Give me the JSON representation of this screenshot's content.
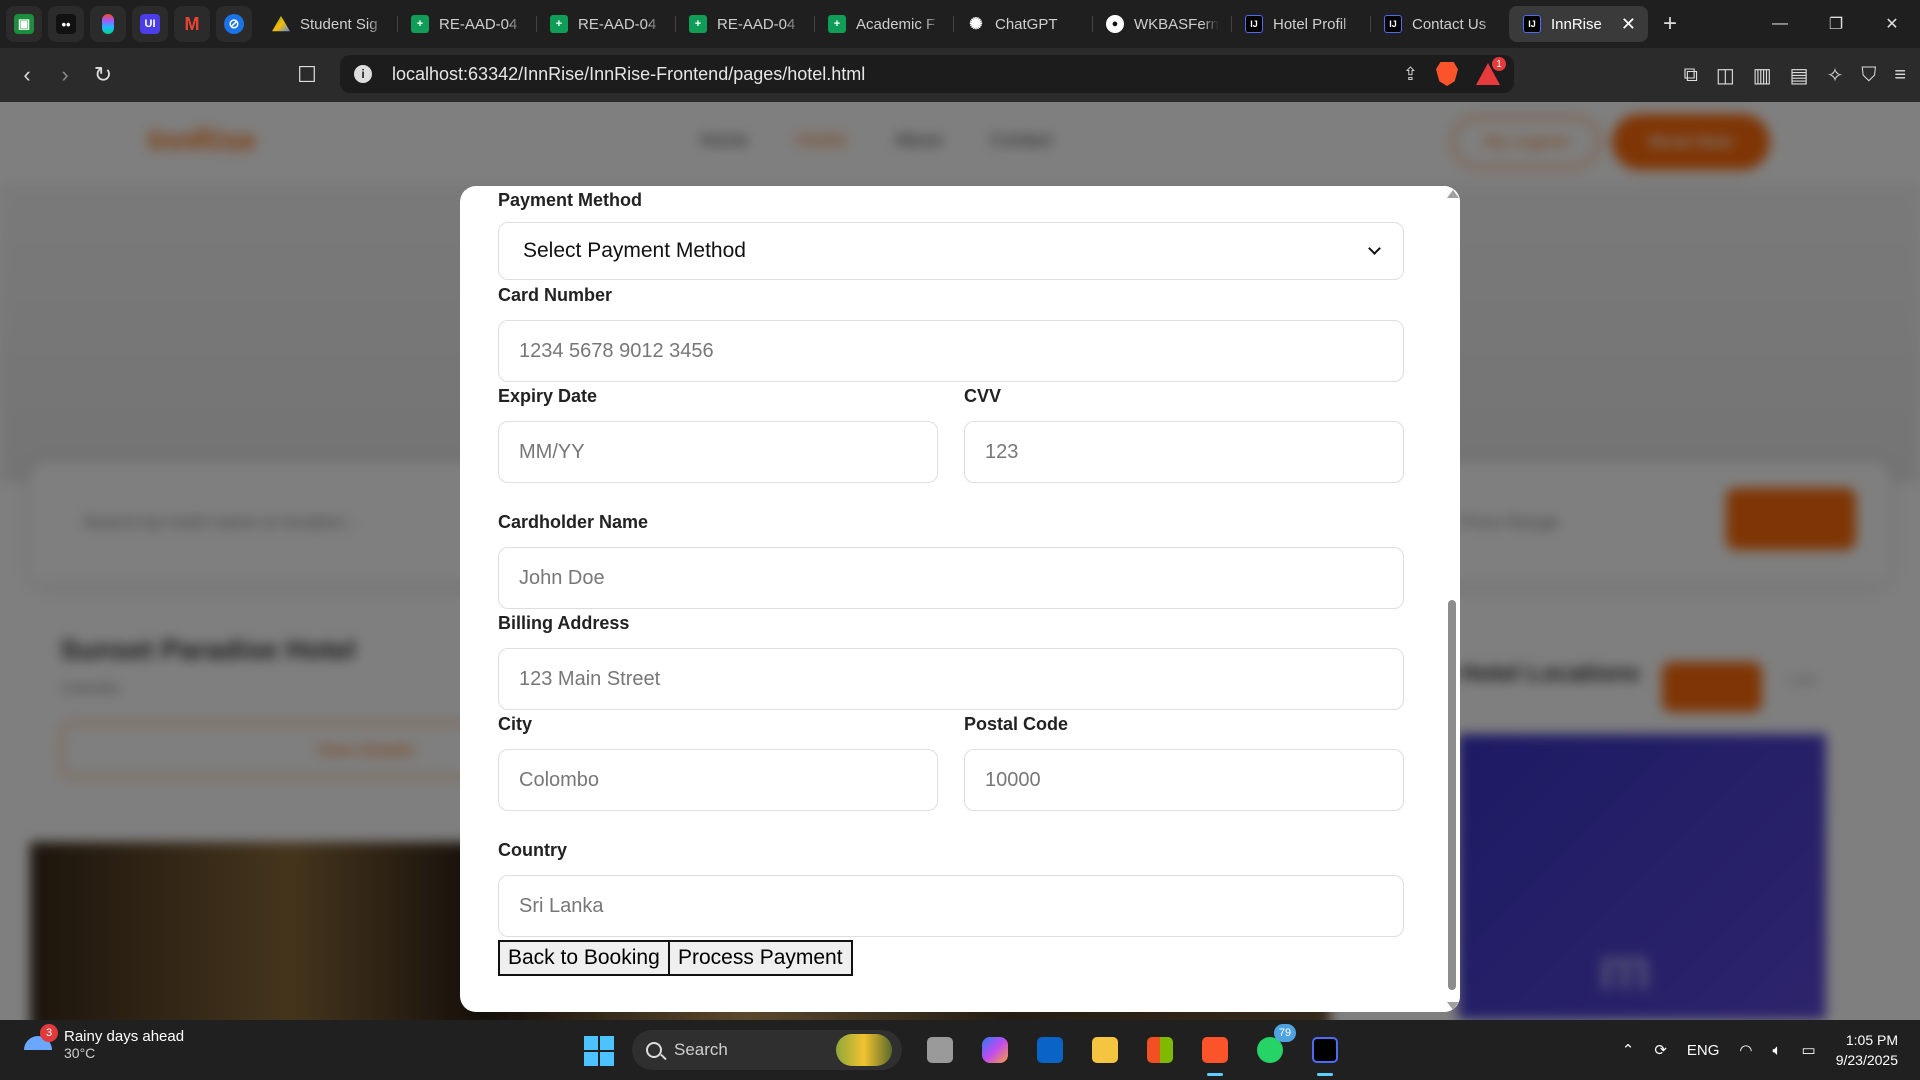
{
  "browser": {
    "pinned_tabs": [
      {
        "icon": "classroom-icon",
        "color": "#1e8e3e"
      },
      {
        "icon": "app-icon",
        "color": "#111111"
      },
      {
        "icon": "figma-icon",
        "color": "#f24e1e"
      },
      {
        "icon": "ui-icon",
        "color": "#4b3ee8"
      },
      {
        "icon": "gmail-icon",
        "color": "#ea4335"
      },
      {
        "icon": "link-icon",
        "color": "#1a73e8"
      }
    ],
    "tabs": [
      {
        "title": "Student Sig",
        "icon": "drive-icon",
        "color": "#34a853",
        "active": false
      },
      {
        "title": "RE-AAD-04",
        "icon": "sheets-icon",
        "color": "#0f9d58",
        "active": false
      },
      {
        "title": "RE-AAD-04",
        "icon": "sheets-icon",
        "color": "#0f9d58",
        "active": false
      },
      {
        "title": "RE-AAD-04",
        "icon": "sheets-icon",
        "color": "#0f9d58",
        "active": false
      },
      {
        "title": "Academic F",
        "icon": "sheets-icon",
        "color": "#0f9d58",
        "active": false
      },
      {
        "title": "ChatGPT",
        "icon": "chatgpt-icon",
        "color": "#ffffff",
        "active": false
      },
      {
        "title": "WKBASFern",
        "icon": "github-icon",
        "color": "#ffffff",
        "active": false
      },
      {
        "title": "Hotel Profil",
        "icon": "intellij-icon",
        "color": "#000000",
        "active": false
      },
      {
        "title": "Contact Us",
        "icon": "intellij-icon",
        "color": "#000000",
        "active": false
      },
      {
        "title": "InnRise",
        "icon": "intellij-icon",
        "color": "#000000",
        "active": true
      }
    ],
    "url": "localhost:63342/InnRise/InnRise-Frontend/pages/hotel.html",
    "rewards_badge": "1"
  },
  "background_page": {
    "logo": "InnRise",
    "nav": [
      "Home",
      "Hotels",
      "About",
      "Contact"
    ],
    "my_account": "My Legend",
    "book_now": "Book Now",
    "search_placeholder": "Search by hotel name or location...",
    "price_range": "Price Range",
    "hotel_name": "Sunset Paradise Hotel",
    "hotel_location": "Colombo",
    "view_details": "View Details",
    "map_title": "Hotel Locations",
    "map_tab": "Map",
    "list_tab": "List"
  },
  "payment_form": {
    "payment_method": {
      "label": "Payment Method",
      "selected": "Select Payment Method"
    },
    "card_number": {
      "label": "Card Number",
      "placeholder": "1234 5678 9012 3456"
    },
    "expiry": {
      "label": "Expiry Date",
      "placeholder": "MM/YY"
    },
    "cvv": {
      "label": "CVV",
      "placeholder": "123"
    },
    "cardholder": {
      "label": "Cardholder Name",
      "placeholder": "John Doe"
    },
    "billing": {
      "label": "Billing Address",
      "placeholder": "123 Main Street"
    },
    "city": {
      "label": "City",
      "placeholder": "Colombo"
    },
    "postal": {
      "label": "Postal Code",
      "placeholder": "10000"
    },
    "country": {
      "label": "Country",
      "placeholder": "Sri Lanka"
    },
    "back_button": "Back to Booking",
    "process_button": "Process Payment"
  },
  "taskbar": {
    "weather_text": "Rainy days ahead",
    "weather_temp": "30°C",
    "weather_badge": "3",
    "search_label": "Search",
    "whatsapp_badge": "79",
    "language": "ENG",
    "time": "1:05 PM",
    "date": "9/23/2025"
  }
}
